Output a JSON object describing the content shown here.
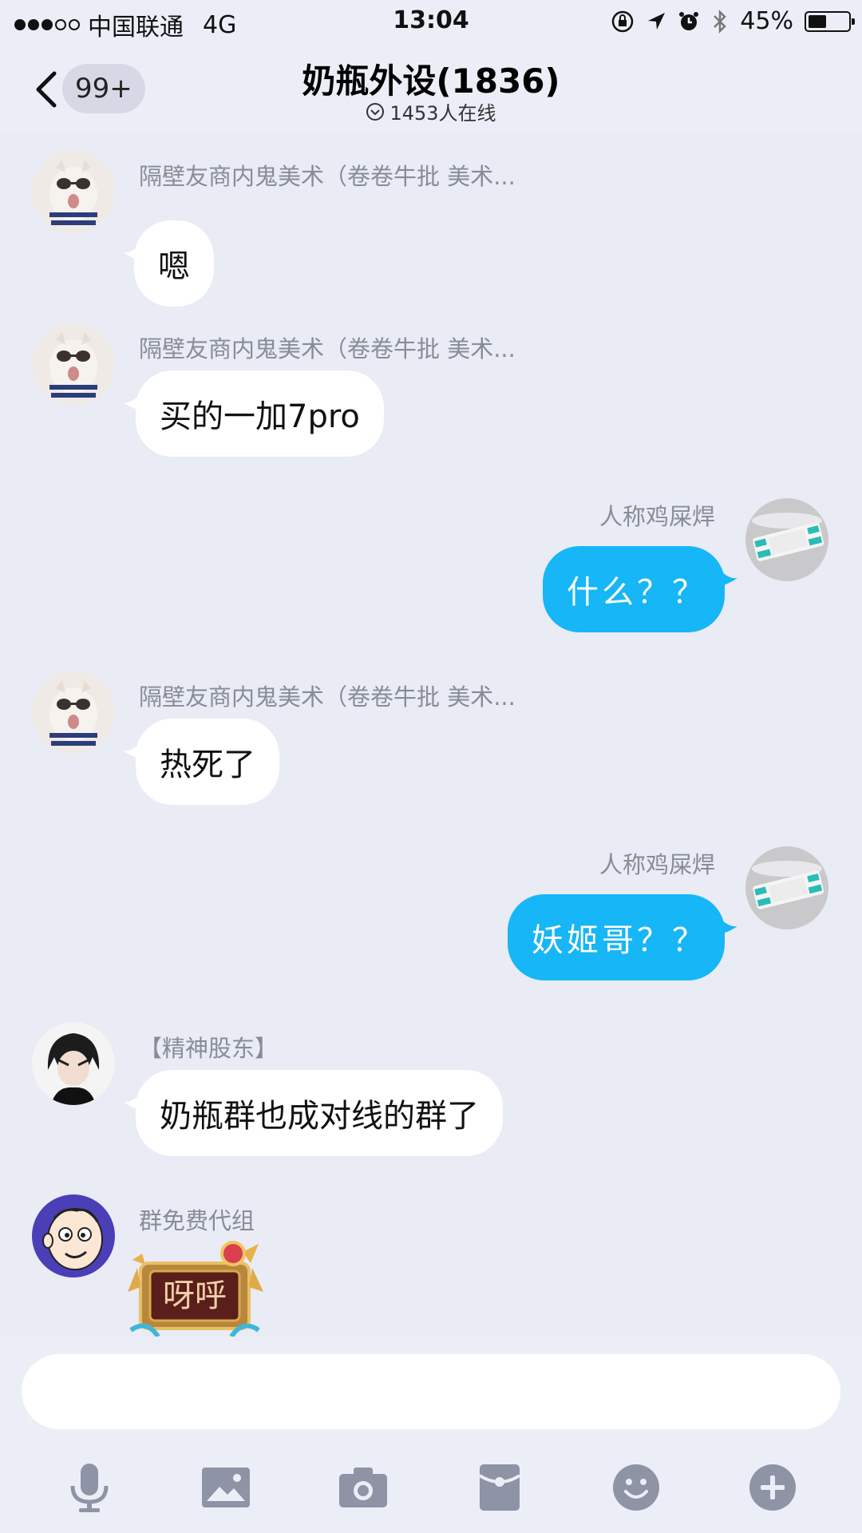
{
  "status_bar": {
    "carrier": "中国联通",
    "network": "4G",
    "time": "13:04",
    "battery": "45%",
    "battery_level": 0.45
  },
  "header": {
    "unread_badge": "99+",
    "title": "奶瓶外设(1836)",
    "online": "1453人在线"
  },
  "messages": [
    {
      "sender": "隔壁友商内鬼美术（卷卷牛批 美术...",
      "text": "嗯",
      "side": "in"
    },
    {
      "sender": "隔壁友商内鬼美术（卷卷牛批 美术...",
      "text": "买的一加7pro",
      "side": "in"
    },
    {
      "sender": "人称鸡屎焊",
      "text": "什么？？",
      "side": "out"
    },
    {
      "sender": "隔壁友商内鬼美术（卷卷牛批 美术...",
      "text": "热死了",
      "side": "in"
    },
    {
      "sender": "人称鸡屎焊",
      "text": "妖姬哥？？",
      "side": "out"
    },
    {
      "sender": "【精神股东】",
      "text": "奶瓶群也成对线的群了",
      "side": "in"
    },
    {
      "sender": "群免费代组",
      "sticker_text": "呀呼",
      "side": "in"
    }
  ],
  "input": {
    "placeholder": "",
    "value": ""
  },
  "toolbar": [
    "mic-icon",
    "image-icon",
    "camera-icon",
    "red-packet-icon",
    "emoji-icon",
    "plus-icon"
  ],
  "colors": {
    "background": "#e9ebf5",
    "outgoing_bubble": "#17b6f6",
    "incoming_bubble": "#ffffff",
    "toolbar_icon": "#8e93a6"
  }
}
